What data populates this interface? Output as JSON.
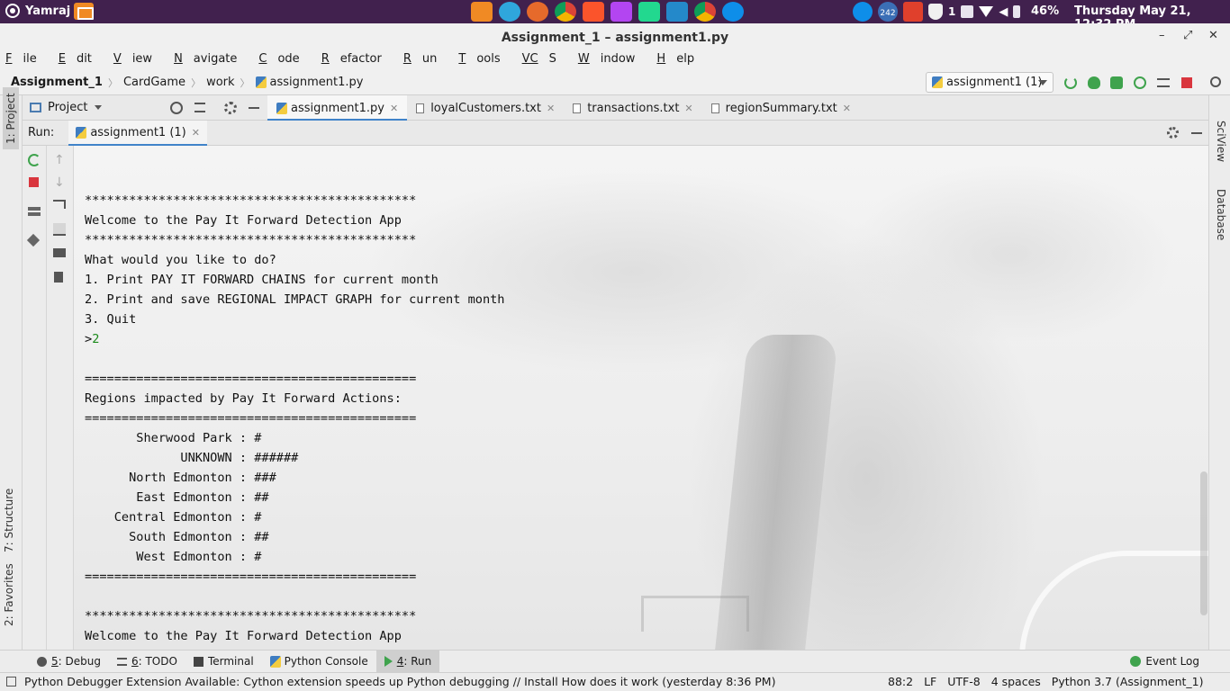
{
  "os_panel": {
    "user": "Yamraj",
    "battery": "46%",
    "datetime": "Thursday May 21, 12:32 PM",
    "teamviewer_badge": "242",
    "app_icons": [
      "files-icon",
      "telegram-icon",
      "firefox-icon",
      "chrome-icon",
      "brave-icon",
      "phpstorm-icon",
      "clion-icon",
      "vscode-icon",
      "chrome-icon",
      "teamviewer-icon"
    ],
    "tray_value": "1"
  },
  "window": {
    "title": "Assignment_1 – assignment1.py",
    "minimize": "–",
    "restore": "⤢",
    "close": "✕"
  },
  "menu": [
    {
      "key": "F",
      "rest": "ile"
    },
    {
      "key": "E",
      "rest": "dit"
    },
    {
      "key": "V",
      "rest": "iew"
    },
    {
      "key": "N",
      "rest": "avigate"
    },
    {
      "key": "C",
      "rest": "ode"
    },
    {
      "key": "R",
      "rest": "efactor"
    },
    {
      "key": "R",
      "rest": "un"
    },
    {
      "key": "T",
      "rest": "ools"
    },
    {
      "key": "VC",
      "rest": "S"
    },
    {
      "key": "W",
      "rest": "indow"
    },
    {
      "key": "H",
      "rest": "elp"
    }
  ],
  "breadcrumb": {
    "project": "Assignment_1",
    "folder1": "CardGame",
    "folder2": "work",
    "file": "assignment1.py"
  },
  "run_config": {
    "label": "assignment1 (1)"
  },
  "project_panel": {
    "label": "Project"
  },
  "editor_tabs": [
    {
      "label": "assignment1.py",
      "active": true
    },
    {
      "label": "loyalCustomers.txt",
      "active": false
    },
    {
      "label": "transactions.txt",
      "active": false
    },
    {
      "label": "regionSummary.txt",
      "active": false
    }
  ],
  "left_stripe": {
    "project": "1: Project",
    "structure": "7: Structure",
    "favorites": "2: Favorites"
  },
  "right_stripe": {
    "sciview": "SciView",
    "database": "Database"
  },
  "run_panel": {
    "label": "Run:",
    "tab": "assignment1 (1)"
  },
  "console": {
    "lines_before": "*********************************************\nWelcome to the Pay It Forward Detection App\n*********************************************\nWhat would you like to do?\n1. Print PAY IT FORWARD CHAINS for current month\n2. Print and save REGIONAL IMPACT GRAPH for current month\n3. Quit\n>",
    "user_input": "2",
    "lines_after": "\n\n=============================================\nRegions impacted by Pay It Forward Actions:\n=============================================\n       Sherwood Park : #\n             UNKNOWN : ######\n      North Edmonton : ###\n       East Edmonton : ##\n    Central Edmonton : #\n      South Edmonton : ##\n       West Edmonton : #\n=============================================\n\n*********************************************\nWelcome to the Pay It Forward Detection App"
  },
  "bottom_tools": [
    {
      "key": "5",
      "rest": ": Debug",
      "active": false,
      "icon": "bug-icon"
    },
    {
      "key": "6",
      "rest": ": TODO",
      "active": false,
      "icon": "list-icon"
    },
    {
      "key": "",
      "rest": "Terminal",
      "active": false,
      "icon": "terminal-icon"
    },
    {
      "key": "",
      "rest": "Python Console",
      "active": false,
      "icon": "python-icon"
    },
    {
      "key": "4",
      "rest": ": Run",
      "active": true,
      "icon": "run-icon"
    }
  ],
  "event_log": "Event Log",
  "status": {
    "message": "Python Debugger Extension Available: Cython extension speeds up Python debugging // Install  How does it work (yesterday 8:36 PM)",
    "position": "88:2",
    "line_sep": "LF",
    "encoding": "UTF-8",
    "indent": "4 spaces",
    "interpreter": "Python 3.7 (Assignment_1)"
  }
}
